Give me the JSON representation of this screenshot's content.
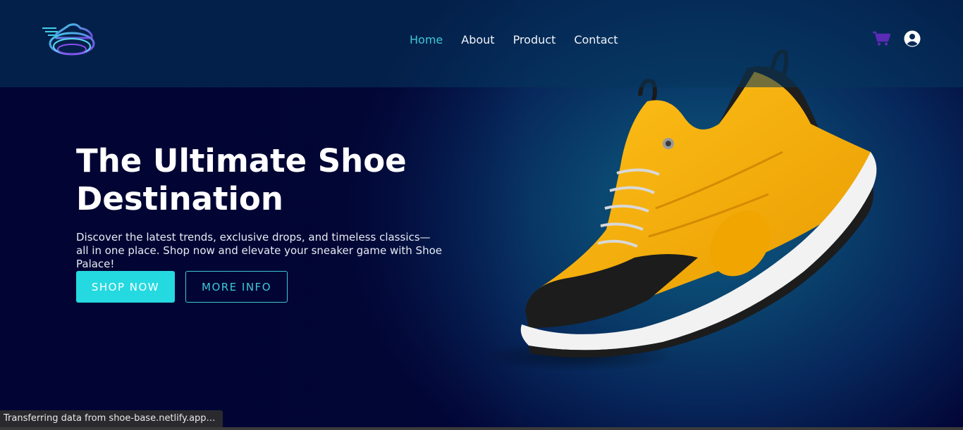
{
  "nav": {
    "links": [
      {
        "label": "Home",
        "active": true
      },
      {
        "label": "About",
        "active": false
      },
      {
        "label": "Product",
        "active": false
      },
      {
        "label": "Contact",
        "active": false
      }
    ],
    "icons": {
      "cart": "cart-icon",
      "user": "user-circle-icon",
      "logo": "sneaker-logo-icon"
    }
  },
  "hero": {
    "title": "The Ultimate Shoe Destination",
    "description": "Discover the latest trends, exclusive drops, and timeless classics—all in one place. Shop now and elevate your sneaker game with Shoe Palace!",
    "primary_button": "SHOP NOW",
    "secondary_button": "MORE INFO"
  },
  "status_bar": {
    "text": "Transferring data from shoe-base.netlify.app…"
  },
  "colors": {
    "accent": "#25d9e0",
    "active_link": "#3fc7d6",
    "cart": "#5b2bb5",
    "background_dark": "#020637",
    "background_glow": "#0b5a84",
    "shoe_yellow": "#f5b400"
  }
}
